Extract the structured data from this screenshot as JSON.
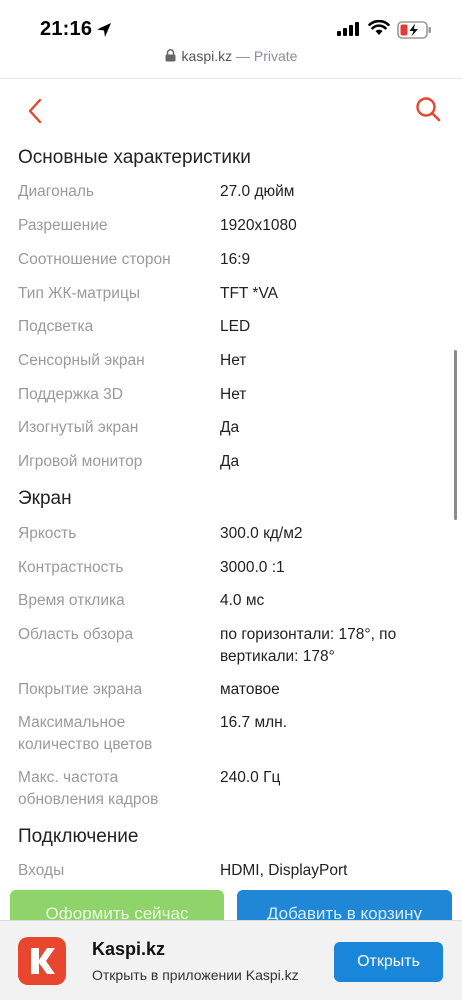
{
  "status_bar": {
    "time": "21:16"
  },
  "url_bar": {
    "domain": "kaspi.kz",
    "suffix": " — Private"
  },
  "sections": [
    {
      "title": "Основные характеристики",
      "rows": [
        {
          "label": "Диагональ",
          "value": "27.0 дюйм"
        },
        {
          "label": "Разрешение",
          "value": "1920x1080"
        },
        {
          "label": "Соотношение сторон",
          "value": "16:9"
        },
        {
          "label": "Тип ЖК-матрицы",
          "value": "TFT *VA"
        },
        {
          "label": "Подсветка",
          "value": "LED"
        },
        {
          "label": "Сенсорный экран",
          "value": "Нет"
        },
        {
          "label": "Поддержка 3D",
          "value": "Нет"
        },
        {
          "label": "Изогнутый экран",
          "value": "Да"
        },
        {
          "label": "Игровой монитор",
          "value": "Да"
        }
      ]
    },
    {
      "title": "Экран",
      "rows": [
        {
          "label": "Яркость",
          "value": "300.0 кд/м2"
        },
        {
          "label": "Контрастность",
          "value": "3000.0 :1"
        },
        {
          "label": "Время отклика",
          "value": "4.0 мс"
        },
        {
          "label": "Область обзора",
          "value": "по горизонтали: 178°, по вертикали: 178°"
        },
        {
          "label": "Покрытие экрана",
          "value": "матовое"
        },
        {
          "label": "Максимальное количество цветов",
          "value": "16.7 млн."
        },
        {
          "label": "Макс. частота обновления кадров",
          "value": "240.0 Гц"
        }
      ]
    },
    {
      "title": "Подключение",
      "rows": [
        {
          "label": "Входы",
          "value": "HDMI, DisplayPort"
        }
      ]
    }
  ],
  "actions": {
    "checkout_label": "Оформить сейчас",
    "cart_label": "Добавить в корзину"
  },
  "app_banner": {
    "name": "Kaspi.kz",
    "subtitle": "Открыть в приложении Kaspi.kz",
    "open_label": "Открыть"
  },
  "colors": {
    "accent_red": "#e8462f",
    "checkout_green": "#8fd36b",
    "cart_blue": "#1f87d6",
    "label_gray": "#9a9a9a"
  }
}
